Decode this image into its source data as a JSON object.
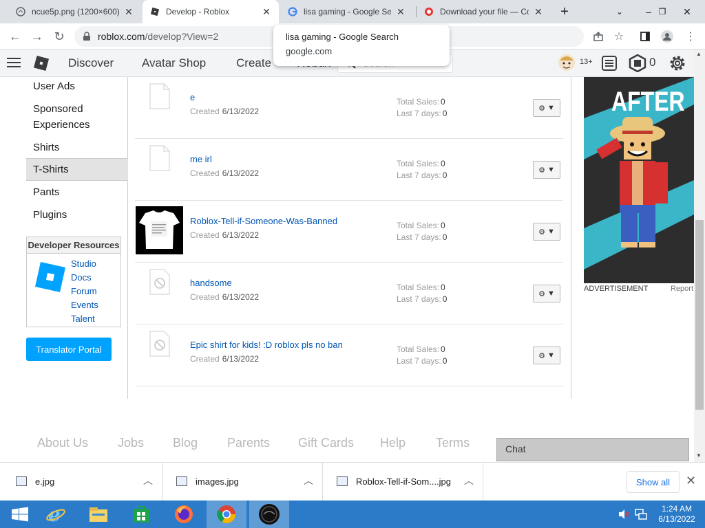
{
  "browser": {
    "tabs": [
      {
        "title": "ncue5p.png (1200×600)",
        "active": false
      },
      {
        "title": "Develop - Roblox",
        "active": true
      },
      {
        "title": "lisa gaming - Google Se",
        "active": false
      },
      {
        "title": "Download your file — Co",
        "active": false
      }
    ],
    "url_host": "roblox.com",
    "url_path": "/develop?View=2",
    "hovercard": {
      "title": "lisa gaming - Google Search",
      "domain": "google.com"
    }
  },
  "roblox_nav": {
    "links": [
      "Discover",
      "Avatar Shop",
      "Create",
      "Robux"
    ],
    "search_placeholder": "Search",
    "age_badge": "13+",
    "robux_count": "0"
  },
  "sidebar": {
    "items": [
      "User Ads",
      "Sponsored",
      "Experiences",
      "Shirts",
      "T-Shirts",
      "Pants",
      "Plugins"
    ],
    "selected": "T-Shirts",
    "dev_resources": {
      "title": "Developer Resources",
      "links": [
        "Studio",
        "Docs",
        "Forum",
        "Events",
        "Talent"
      ]
    },
    "translator_button": "Translator Portal"
  },
  "items": {
    "created_label": "Created",
    "total_sales_label": "Total Sales:",
    "last7_label": "Last 7 days:",
    "rows": [
      {
        "name": "e",
        "created": "6/13/2022",
        "total_sales": "0",
        "last_7_days": "0",
        "thumb": "placeholder"
      },
      {
        "name": "me irl",
        "created": "6/13/2022",
        "total_sales": "0",
        "last_7_days": "0",
        "thumb": "placeholder"
      },
      {
        "name": "Roblox-Tell-if-Someone-Was-Banned",
        "created": "6/13/2022",
        "total_sales": "0",
        "last_7_days": "0",
        "thumb": "tshirt"
      },
      {
        "name": "handsome",
        "created": "6/13/2022",
        "total_sales": "0",
        "last_7_days": "0",
        "thumb": "blocked"
      },
      {
        "name": "Epic shirt for kids! :D roblox pls no ban",
        "created": "6/13/2022",
        "total_sales": "0",
        "last_7_days": "0",
        "thumb": "blocked"
      }
    ]
  },
  "ad": {
    "headline": "AFTER",
    "label": "ADVERTISEMENT",
    "report": "Report"
  },
  "footer": {
    "links": [
      "About Us",
      "Jobs",
      "Blog",
      "Parents",
      "Gift Cards",
      "Help",
      "Terms"
    ],
    "chat": "Chat"
  },
  "downloads": {
    "files": [
      "e.jpg",
      "images.jpg",
      "Roblox-Tell-if-Som....jpg"
    ],
    "show_all": "Show all"
  },
  "taskbar": {
    "time": "1:24 AM",
    "date": "6/13/2022"
  },
  "colors": {
    "link_blue": "#0055b3",
    "roblox_blue": "#00a2ff",
    "taskbar": "#2b7bc8"
  }
}
